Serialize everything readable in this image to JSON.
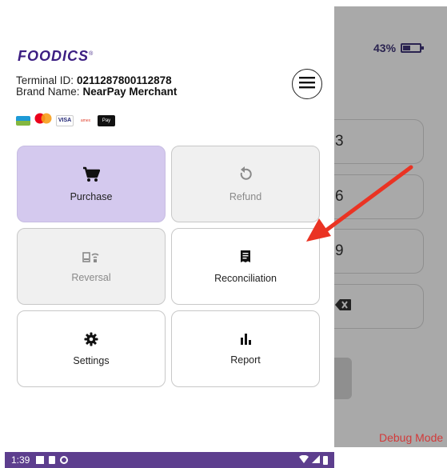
{
  "background": {
    "battery_percent": "43%",
    "battery_level": 0.43,
    "keys": [
      "3",
      "6",
      "9"
    ],
    "debug_label": "Debug Mode"
  },
  "drawer": {
    "brand_logo": "FOODICS",
    "terminal_id_label": "Terminal ID:",
    "terminal_id_value": "0211287800112878",
    "brand_name_label": "Brand Name:",
    "brand_name_value": "NearPay Merchant",
    "menu_icon": "hamburger-icon",
    "card_logos": [
      "mada",
      "mastercard",
      "visa",
      "american-express",
      "apple-pay"
    ],
    "tiles": [
      {
        "label": "Purchase",
        "icon": "cart-icon",
        "state": "active"
      },
      {
        "label": "Refund",
        "icon": "refresh-icon",
        "state": "disabled"
      },
      {
        "label": "Reversal",
        "icon": "contactless-icon",
        "state": "disabled"
      },
      {
        "label": "Reconciliation",
        "icon": "receipt-icon",
        "state": "enabled"
      },
      {
        "label": "Settings",
        "icon": "gear-icon",
        "state": "enabled"
      },
      {
        "label": "Report",
        "icon": "bar-chart-icon",
        "state": "enabled"
      }
    ]
  },
  "status_bar": {
    "time": "1:39"
  },
  "colors": {
    "brand": "#3c1e82",
    "active_tile": "#d4c9ee",
    "status_bar": "#5d3e8e",
    "annotation_arrow": "#ea3323",
    "debug_text": "#d23a3a"
  }
}
